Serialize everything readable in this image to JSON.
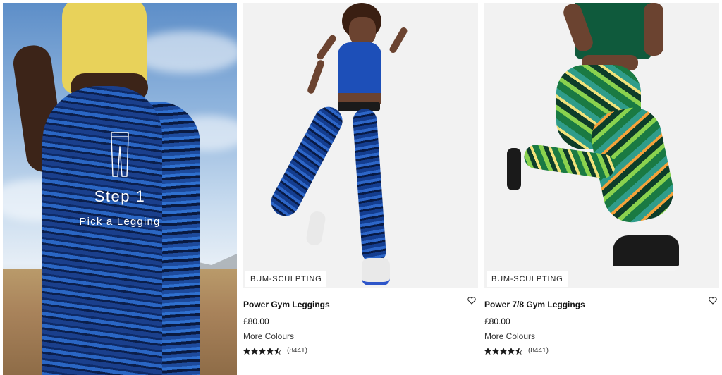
{
  "promo": {
    "step": "Step 1",
    "subtitle": "Pick a Legging",
    "icon": "legging-outline-icon"
  },
  "products": [
    {
      "badge": "BUM-SCULPTING",
      "name": "Power Gym Leggings",
      "price": "£80.00",
      "colours": "More Colours",
      "rating": 4.5,
      "review_count": "(8441)",
      "wishlist_icon": "heart-icon"
    },
    {
      "badge": "BUM-SCULPTING",
      "name": "Power 7/8 Gym Leggings",
      "price": "£80.00",
      "colours": "More Colours",
      "rating": 4.5,
      "review_count": "(8441)",
      "wishlist_icon": "heart-icon"
    }
  ],
  "colors": {
    "text": "#111111",
    "image_bg": "#f2f2f2",
    "star": "#1a1a1a"
  }
}
